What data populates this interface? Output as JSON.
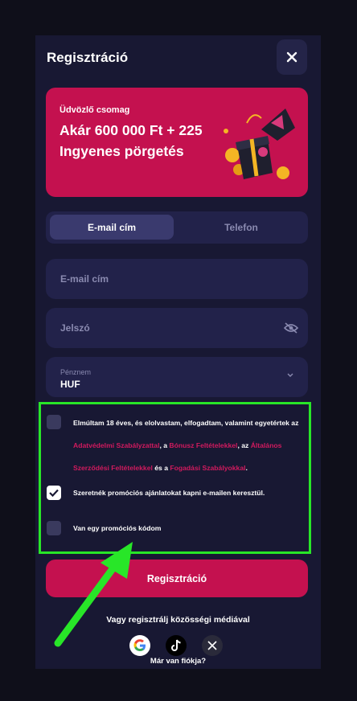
{
  "modal": {
    "title": "Regisztráció"
  },
  "banner": {
    "subtitle": "Üdvözlő csomag",
    "headline": "Akár 600 000 Ft + 225 Ingyenes pörgetés"
  },
  "tabs": [
    {
      "label": "E-mail cím",
      "active": true
    },
    {
      "label": "Telefon",
      "active": false
    }
  ],
  "form": {
    "email_placeholder": "E-mail cím",
    "password_placeholder": "Jelszó",
    "currency_label": "Pénznem",
    "currency_value": "HUF"
  },
  "consent": {
    "line1": "Elmúltam 18 éves, és elolvastam, elfogadtam, valamint egyetértek az",
    "link_privacy": "Adatvédelmi Szabályzattal",
    "sep1": ", a",
    "link_bonus": "Bónusz Feltételekkel",
    "sep2": ", az",
    "link_general_a": "Általános",
    "link_general_b": "Szerződési Feltételekkel",
    "sep3": "és a",
    "link_betting": "Fogadási Szabályokkal",
    "end": ".",
    "checked": false
  },
  "promo_emails": {
    "label": "Szeretnék promóciós ajánlatokat kapni e-mailen keresztül.",
    "checked": true
  },
  "promo_code": {
    "label": "Van egy promóciós kódom",
    "checked": false
  },
  "register_button": "Regisztráció",
  "social": {
    "text": "Vagy regisztrálj közösségi médiával",
    "providers": [
      "google-icon",
      "tiktok-icon",
      "x-icon"
    ]
  },
  "login_link": "Már van fiókja?",
  "colors": {
    "background": "#0f0f1a",
    "modal": "#181833",
    "accent": "#c4114f",
    "field": "#22224a",
    "highlight": "#28e628"
  }
}
